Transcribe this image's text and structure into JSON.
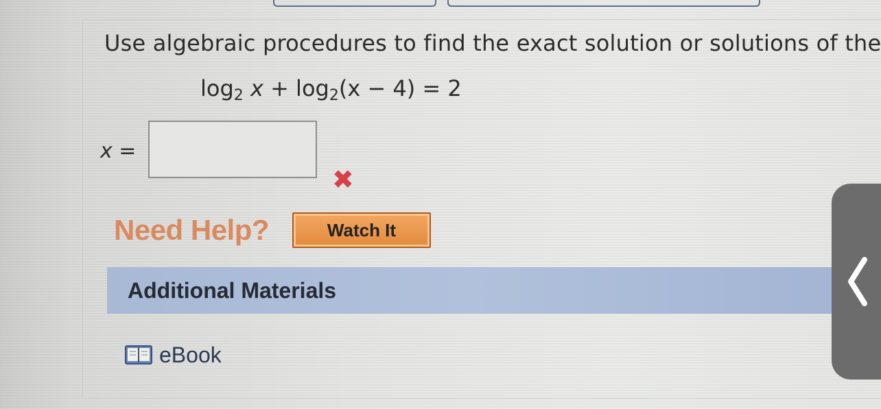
{
  "question": {
    "prompt": "Use algebraic procedures to find the exact solution or solutions of the ec",
    "equation": {
      "log_word": "log",
      "base": "2",
      "var_x": "x",
      "plus": " + ",
      "inner": "(x − 4)",
      "rhs": " = 2"
    }
  },
  "answer": {
    "label_var": "x",
    "label_eq": " =",
    "value": "",
    "status_icon": "x-mark-icon",
    "status_color": "#d8404c"
  },
  "help": {
    "title": "Need Help?",
    "watch_button": "Watch It",
    "title_color": "#d98a5f",
    "button_color": "#e8923f"
  },
  "materials": {
    "header": "Additional Materials",
    "header_color": "#a8b9d6",
    "items": [
      {
        "label": "eBook",
        "icon": "book-icon"
      }
    ]
  },
  "side_tab": {
    "icon": "chevron-left-icon"
  }
}
